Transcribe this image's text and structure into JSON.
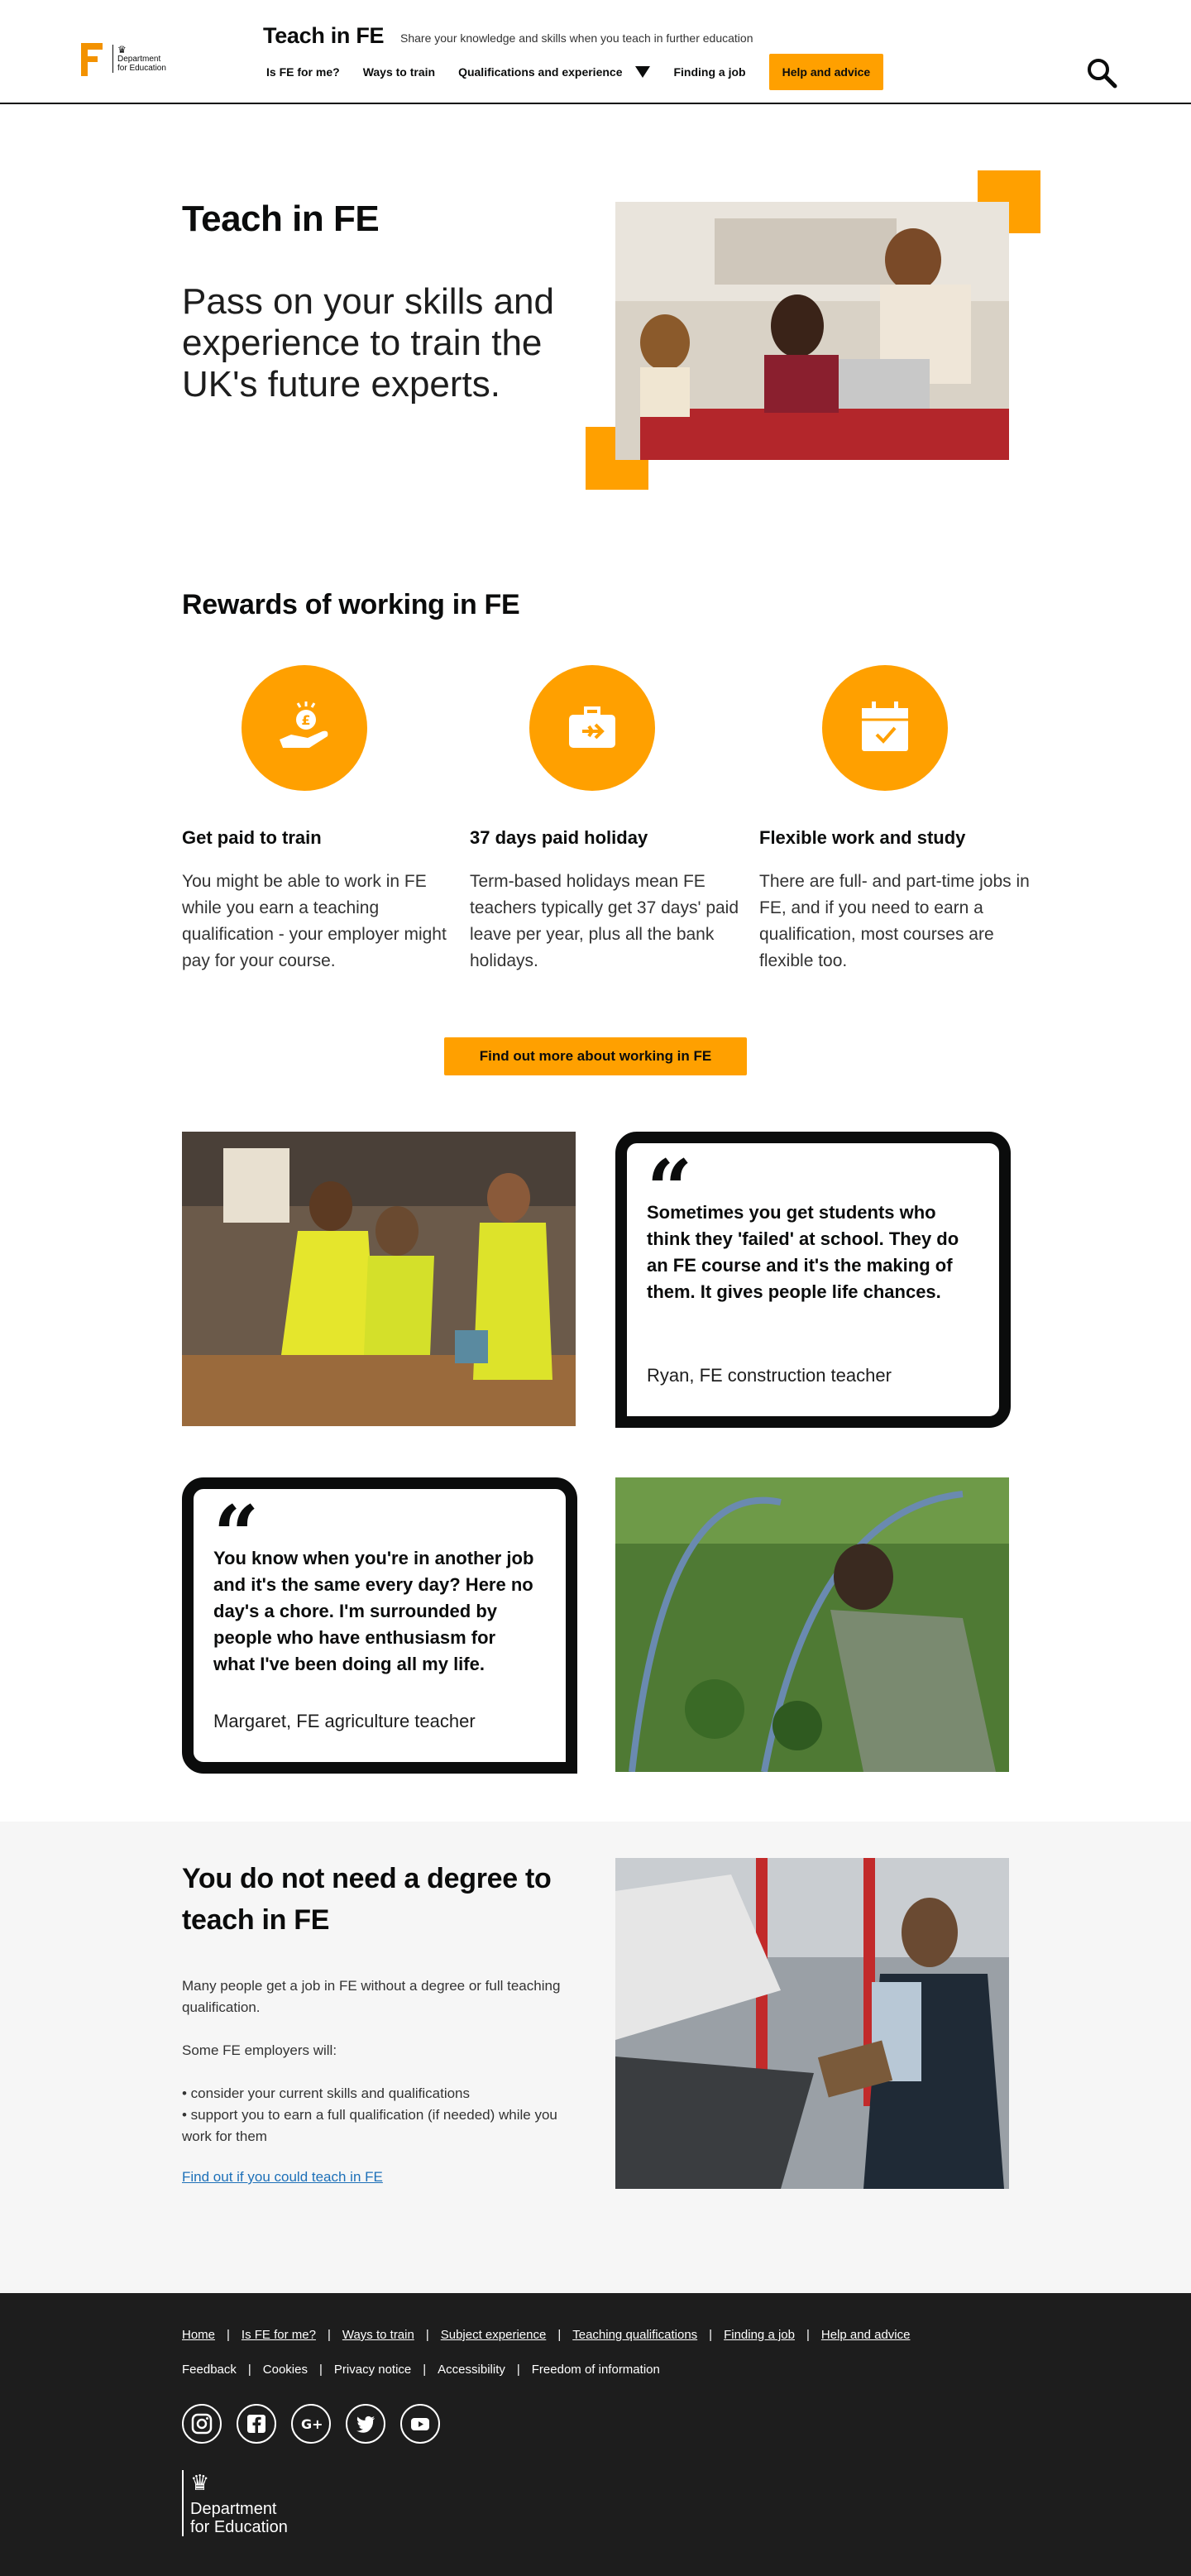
{
  "header": {
    "logo_dept_line1": "Department",
    "logo_dept_line2": "for Education",
    "site_title": "Teach in FE",
    "tagline": "Share your knowledge and skills when you teach in further education",
    "nav": [
      "Is FE for me?",
      "Ways to train",
      "Qualifications and experience",
      "Finding a job"
    ],
    "cta": "Help and advice",
    "search_icon": "search-icon"
  },
  "hero": {
    "title": "Teach in FE",
    "subtitle": "Pass on your skills and experience to train the UK's future experts."
  },
  "rewards": {
    "title": "Rewards of working in FE",
    "items": [
      {
        "icon": "hand-coin-icon",
        "title": "Get paid to train",
        "text": "You might be able to work in FE while you earn a teaching qualification - your employer might pay for your course."
      },
      {
        "icon": "suitcase-plane-icon",
        "title": "37 days paid holiday",
        "text": "Term-based holidays mean FE teachers typically get 37 days' paid leave per year, plus all the bank holidays."
      },
      {
        "icon": "calendar-check-icon",
        "title": "Flexible work and study",
        "text": "There are full- and part-time jobs in FE, and if you need to earn a qualification, most courses are flexible too."
      }
    ],
    "cta": "Find out more about working in FE"
  },
  "quotes": [
    {
      "text": "Sometimes you get students who think they 'failed' at school. They do an FE course and it's the making of them. It gives people life chances.",
      "author": "Ryan, FE construction teacher"
    },
    {
      "text": "You know when you're in another job and it's the same every day? Here no day's a chore. I'm surrounded by people who have enthusiasm for what I've been doing all my life.",
      "author": "Margaret, FE agriculture teacher"
    }
  ],
  "degree": {
    "title": "You do not need a degree to teach in FE",
    "para1": "Many people get a job in FE without a degree or full teaching qualification.",
    "para2": "Some FE employers will:",
    "bullet1": "• consider your current skills and qualifications",
    "bullet2": "• support you to earn a full qualification (if needed) while you work for them",
    "link": "Find out if you could teach in FE"
  },
  "footer": {
    "links": [
      "Home",
      "Is FE for me?",
      "Ways to train",
      "Subject experience",
      "Teaching qualifications",
      "Finding a job",
      "Help and advice"
    ],
    "secondary": [
      "Feedback",
      "Cookies",
      "Privacy notice",
      "Accessibility",
      "Freedom of information"
    ],
    "socials": [
      "instagram-icon",
      "facebook-icon",
      "google-plus-icon",
      "twitter-icon",
      "youtube-icon"
    ],
    "dept_line1": "Department",
    "dept_line2": "for Education"
  },
  "colors": {
    "accent": "#ffa000",
    "footer_bg": "#1d1d1d",
    "link": "#1d70b8",
    "text": "#0b0c0c"
  }
}
